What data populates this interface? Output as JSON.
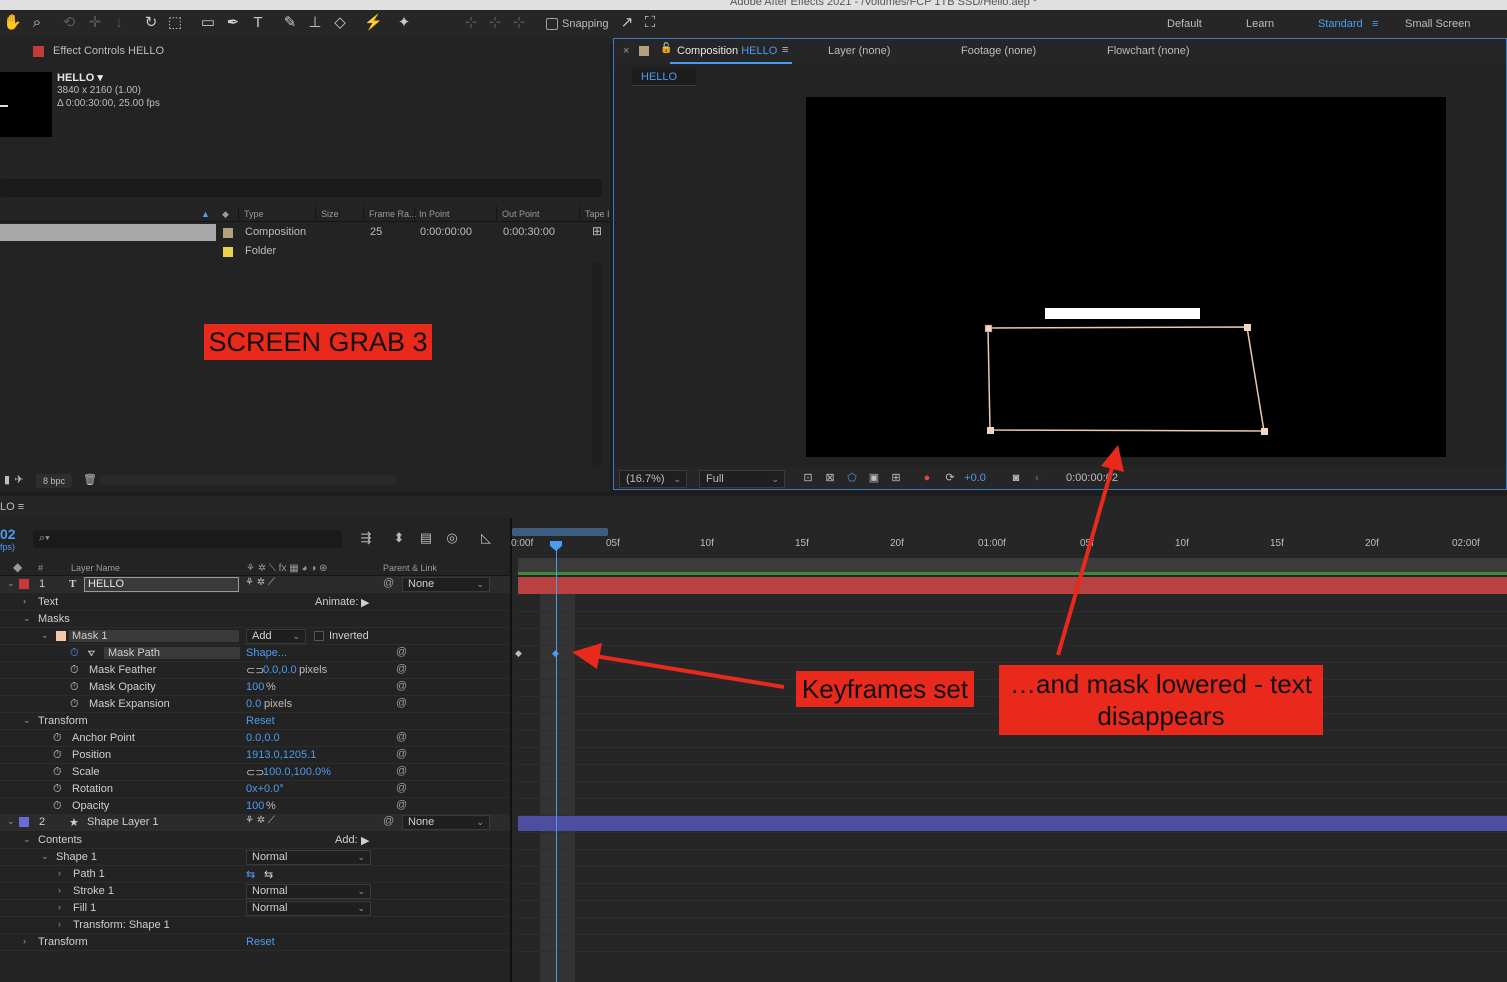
{
  "window": {
    "title": "Adobe After Effects 2021 - /Volumes/FCP 1TB SSD/Hello.aep *"
  },
  "toolbar": {
    "snapping_label": "Snapping",
    "workspaces": [
      "Default",
      "Learn",
      "Standard",
      "Small Screen"
    ],
    "active_workspace": "Standard"
  },
  "effect_controls": {
    "tab_label": "Effect Controls HELLO"
  },
  "project": {
    "item_name": "HELLO ▾",
    "item_dimensions": "3840 x 2160 (1.00)",
    "item_duration": "Δ 0:00:30:00, 25.00 fps",
    "columns": [
      "Type",
      "Size",
      "Frame Ra...",
      "In Point",
      "Out Point",
      "Tape I"
    ],
    "rows": [
      {
        "type": "Composition",
        "frame_rate": "25",
        "in_point": "0:00:00:00",
        "out_point": "0:00:30:00",
        "color": "#b4a07a"
      },
      {
        "type": "Folder",
        "frame_rate": "",
        "in_point": "",
        "out_point": "",
        "color": "#e6d34a"
      }
    ],
    "bpc_label": "8 bpc"
  },
  "composition": {
    "tab_label": "Composition",
    "tab_comp_name": "HELLO",
    "other_tabs": [
      "Layer (none)",
      "Footage (none)",
      "Flowchart (none)"
    ],
    "breadcrumb": "HELLO",
    "zoom": "(16.7%)",
    "resolution": "Full",
    "exposure": "+0.0",
    "timecode": "0:00:00:02"
  },
  "timeline": {
    "tab_label": "LO",
    "current_time": "02",
    "fps_label": "fps)",
    "search_placeholder": "⌕▾",
    "columns": {
      "layer_name": "Layer Name",
      "hash": "#",
      "parent": "Parent & Link"
    },
    "ruler_ticks": [
      "0:00f",
      "05f",
      "10f",
      "15f",
      "20f",
      "01:00f",
      "05f",
      "10f",
      "15f",
      "20f",
      "02:00f"
    ],
    "layers": [
      {
        "index": "1",
        "icon": "T",
        "name": "HELLO",
        "parent": "None",
        "color": "#c73a3a"
      },
      {
        "index": "2",
        "icon": "★",
        "name": "Shape Layer 1",
        "parent": "None",
        "color": "#6b6bd6"
      }
    ],
    "props": {
      "text": "Text",
      "animate": "Animate:",
      "masks": "Masks",
      "mask1": "Mask 1",
      "mask_mode": "Add",
      "inverted": "Inverted",
      "mask_path": "Mask Path",
      "mask_path_val": "Shape...",
      "mask_feather": "Mask Feather",
      "mask_feather_val": "0.0,0.0",
      "mask_feather_unit": "pixels",
      "mask_opacity": "Mask Opacity",
      "mask_opacity_val": "100",
      "mask_opacity_unit": "%",
      "mask_expansion": "Mask Expansion",
      "mask_expansion_val": "0.0",
      "mask_expansion_unit": "pixels",
      "transform": "Transform",
      "reset": "Reset",
      "anchor": "Anchor Point",
      "anchor_val": "0.0,0.0",
      "position": "Position",
      "position_val": "1913.0,1205.1",
      "scale": "Scale",
      "scale_val": "100.0,100.0%",
      "rotation": "Rotation",
      "rotation_val": "0x+0.0°",
      "opacity": "Opacity",
      "opacity_val": "100",
      "opacity_unit": "%",
      "contents": "Contents",
      "add": "Add:",
      "shape1": "Shape 1",
      "normal": "Normal",
      "path1": "Path 1",
      "stroke1": "Stroke 1",
      "fill1": "Fill 1",
      "transform_shape1": "Transform: Shape 1"
    }
  },
  "annotations": {
    "screen_grab": "SCREEN GRAB 3",
    "keyframes_set": "Keyframes set",
    "mask_lowered_line1": "…and mask lowered - text",
    "mask_lowered_line2": "disappears"
  }
}
